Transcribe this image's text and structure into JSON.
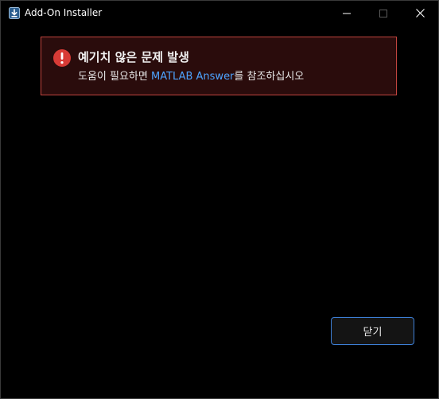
{
  "window": {
    "title": "Add-On Installer",
    "icons": {
      "app": "matlab-addon-installer-icon",
      "minimize": "minimize-icon",
      "maximize": "maximize-icon",
      "close": "close-icon"
    }
  },
  "alert": {
    "icon": "error-icon",
    "title": "예기치 않은 문제 발생",
    "message_prefix": "도움이 필요하면 ",
    "link_text": "MATLAB Answer",
    "message_suffix": "를 참조하십시오",
    "colors": {
      "background": "#2a0c0c",
      "border": "#c2453f",
      "icon": "#d83b36",
      "link": "#4da3ff"
    }
  },
  "footer": {
    "close_button_label": "닫기",
    "close_button_border": "#3d7fd6"
  }
}
